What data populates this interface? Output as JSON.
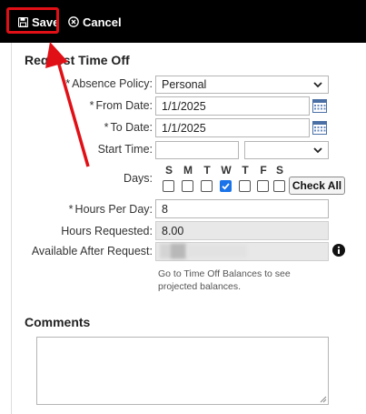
{
  "toolbar": {
    "save_label": "Save",
    "cancel_label": "Cancel",
    "save_icon": "floppy-disk-icon",
    "cancel_icon": "circle-x-icon"
  },
  "form": {
    "title": "Request Time Off",
    "absence_policy": {
      "label": "Absence Policy:",
      "required_mark": "*",
      "value": "Personal"
    },
    "from_date": {
      "label": "From Date:",
      "required_mark": "*",
      "value": "1/1/2025"
    },
    "to_date": {
      "label": "To Date:",
      "required_mark": "*",
      "value": "1/1/2025"
    },
    "start_time": {
      "label": "Start Time:",
      "value": "",
      "select_value": ""
    },
    "days": {
      "label": "Days:",
      "letters": [
        "S",
        "M",
        "T",
        "W",
        "T",
        "F",
        "S"
      ],
      "checked": [
        false,
        false,
        false,
        true,
        false,
        false,
        false
      ],
      "check_all_label": "Check All"
    },
    "hours_per_day": {
      "label": "Hours Per Day:",
      "required_mark": "*",
      "value": "8"
    },
    "hours_requested": {
      "label": "Hours Requested:",
      "value": "8.00"
    },
    "available_after": {
      "label": "Available After Request:",
      "value": ""
    },
    "hint": "Go to Time Off Balances to see projected balances."
  },
  "comments": {
    "title": "Comments",
    "value": ""
  },
  "colors": {
    "toolbar_bg": "#000000",
    "highlight": "#e01016",
    "checkbox_checked": "#1a73e8"
  }
}
